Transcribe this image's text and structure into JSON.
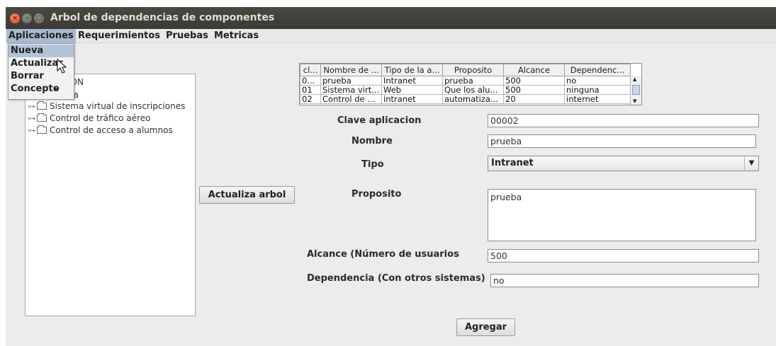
{
  "window": {
    "title": "Arbol de dependencias de componentes",
    "close_glyph": "×",
    "min_glyph": "–",
    "max_glyph": "□"
  },
  "menubar": {
    "items": [
      "Aplicaciones",
      "Requerimientos",
      "Pruebas",
      "Metricas"
    ]
  },
  "dropdown": {
    "items": [
      "Nueva",
      "Actualizar",
      "Borrar",
      "Concepto"
    ],
    "submenu_glyph": "▸"
  },
  "tree": {
    "nodes": [
      {
        "label": "ION",
        "partial": true
      },
      {
        "label": "ba",
        "partial": true
      },
      {
        "label": "Sistema virtual de inscripciones"
      },
      {
        "label": "Control de tráfico aéreo"
      },
      {
        "label": "Control de acceso a alumnos"
      }
    ],
    "key_glyph": "⊶"
  },
  "buttons": {
    "update_tree": "Actualiza arbol",
    "add": "Agregar"
  },
  "table": {
    "headers": [
      "cl...",
      "Nombre de ...",
      "Tipo de la a...",
      "Proposito",
      "Alcance",
      "Dependenc..."
    ],
    "rows": [
      [
        "0...",
        "prueba",
        "Intranet",
        "prueba",
        "500",
        "no"
      ],
      [
        "01",
        "Sistema virt...",
        "Web",
        "Que los alu...",
        "500",
        "ninguna"
      ],
      [
        "02",
        "Control de ...",
        "intranet",
        "automatiza...",
        "20",
        "internet"
      ]
    ],
    "scroll_up": "▲",
    "scroll_down": "▼"
  },
  "form": {
    "clave_label": "Clave aplicacion",
    "clave_value": "00002",
    "nombre_label": "Nombre",
    "nombre_value": "prueba",
    "tipo_label": "Tipo",
    "tipo_value": "Intranet",
    "tipo_arrow": "▼",
    "proposito_label": "Proposito",
    "proposito_value": "prueba",
    "alcance_label": "Alcance (Número de usuarios",
    "alcance_value": "500",
    "dependencia_label": "Dependencia (Con otros sistemas)",
    "dependencia_value": "no"
  },
  "colors": {
    "menu_active": "#a9b9cf",
    "titlebar": "#3b3a36",
    "close_button": "#df4a20"
  }
}
